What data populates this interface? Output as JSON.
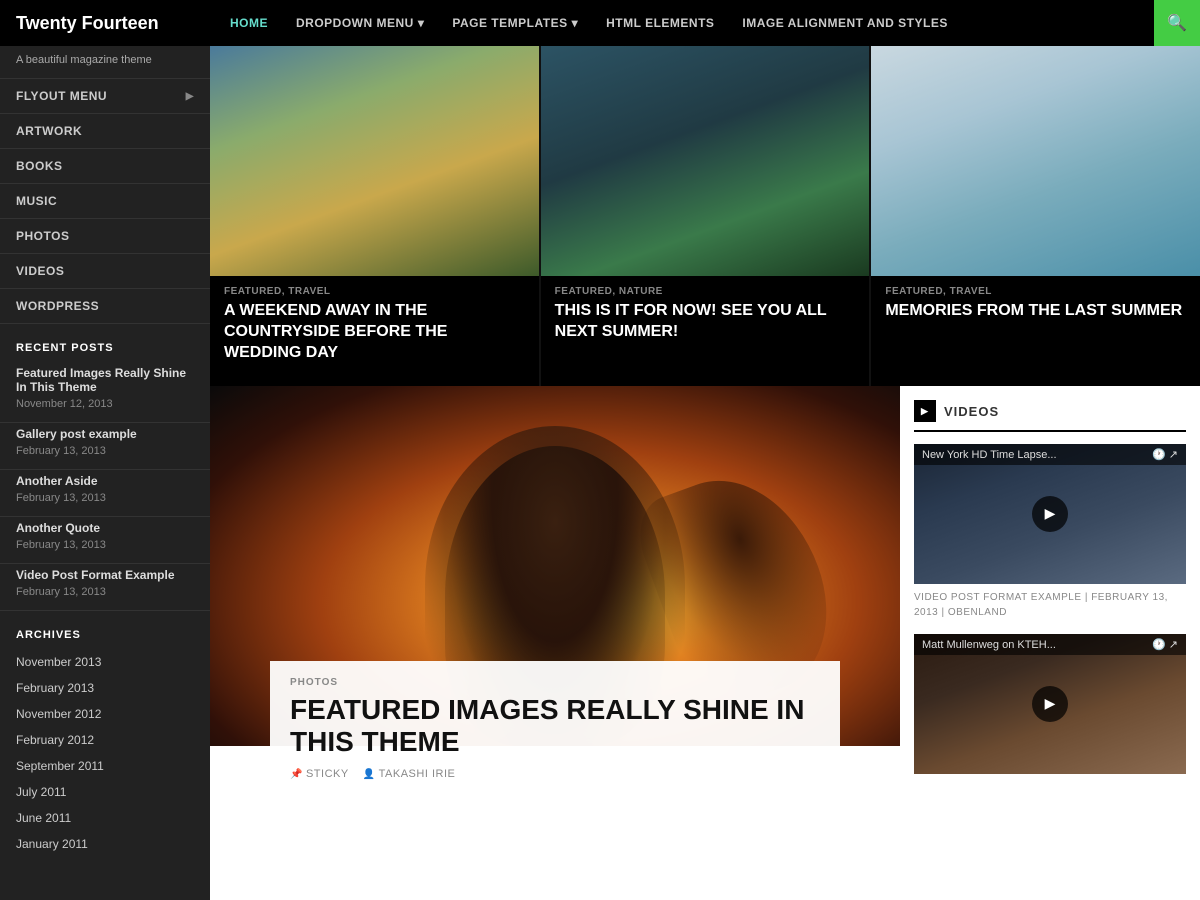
{
  "site": {
    "title": "Twenty Fourteen",
    "tagline": "A beautiful magazine theme"
  },
  "nav": {
    "items": [
      {
        "label": "HOME",
        "active": true
      },
      {
        "label": "DROPDOWN MENU",
        "hasArrow": true
      },
      {
        "label": "PAGE TEMPLATES",
        "hasArrow": true
      },
      {
        "label": "HTML ELEMENTS",
        "hasArrow": false
      },
      {
        "label": "IMAGE ALIGNMENT AND STYLES",
        "hasArrow": false
      }
    ]
  },
  "sidebar": {
    "menu": [
      {
        "label": "FLYOUT MENU",
        "hasArrow": true
      },
      {
        "label": "ARTWORK",
        "hasArrow": false
      },
      {
        "label": "BOOKS",
        "hasArrow": false
      },
      {
        "label": "MUSIC",
        "hasArrow": false
      },
      {
        "label": "PHOTOS",
        "hasArrow": false
      },
      {
        "label": "VIDEOS",
        "hasArrow": false
      },
      {
        "label": "WORDPRESS",
        "hasArrow": false
      }
    ],
    "recent_posts_title": "RECENT POSTS",
    "recent_posts": [
      {
        "title": "Featured Images Really Shine In This Theme",
        "date": "November 12, 2013"
      },
      {
        "title": "Gallery post example",
        "date": "February 13, 2013"
      },
      {
        "title": "Another Aside",
        "date": "February 13, 2013"
      },
      {
        "title": "Another Quote",
        "date": "February 13, 2013"
      },
      {
        "title": "Video Post Format Example",
        "date": "February 13, 2013"
      }
    ],
    "archives_title": "ARCHIVES",
    "archives": [
      "November 2013",
      "February 2013",
      "November 2012",
      "February 2012",
      "September 2011",
      "July 2011",
      "June 2011",
      "January 2011"
    ]
  },
  "hero_slides": [
    {
      "tags": "FEATURED, TRAVEL",
      "title": "A WEEKEND AWAY IN THE COUNTRYSIDE BEFORE THE WEDDING DAY"
    },
    {
      "tags": "FEATURED, NATURE",
      "title": "THIS IS IT FOR NOW! SEE YOU ALL NEXT SUMMER!"
    },
    {
      "tags": "FEATURED, TRAVEL",
      "title": "MEMORIES FROM THE LAST SUMMER"
    }
  ],
  "featured_post": {
    "category": "PHOTOS",
    "title": "FEATURED IMAGES REALLY SHINE IN THIS THEME",
    "sticky_label": "STICKY",
    "author_label": "TAKASHI IRIE"
  },
  "videos_widget": {
    "title": "VIDEOS",
    "items": [
      {
        "title": "New York HD Time Lapse...",
        "meta": "VIDEO POST FORMAT EXAMPLE | FEBRUARY 13, 2013 | OBENLAND"
      },
      {
        "title": "Matt Mullenweg on KTEH...",
        "meta": ""
      }
    ]
  }
}
